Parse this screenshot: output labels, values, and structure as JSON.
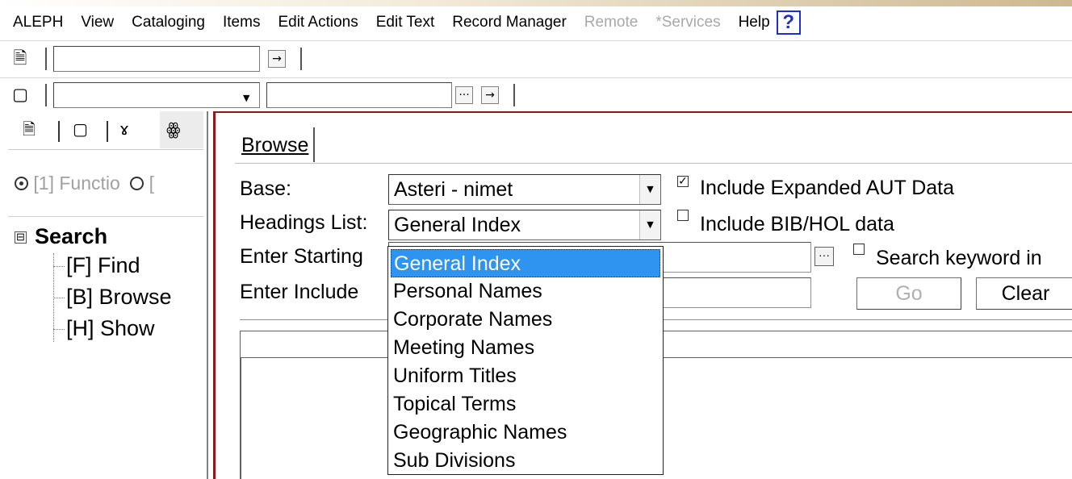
{
  "menubar": {
    "items": [
      {
        "label": "ALEPH",
        "disabled": false
      },
      {
        "label": "View",
        "disabled": false
      },
      {
        "label": "Cataloging",
        "disabled": false
      },
      {
        "label": "Items",
        "disabled": false
      },
      {
        "label": "Edit Actions",
        "disabled": false
      },
      {
        "label": "Edit Text",
        "disabled": false
      },
      {
        "label": "Record Manager",
        "disabled": false
      },
      {
        "label": "Remote",
        "disabled": true
      },
      {
        "label": "*Services",
        "disabled": true
      },
      {
        "label": "Help",
        "disabled": false
      }
    ],
    "help_glyph": "?"
  },
  "toolbar1": {
    "input_value": "",
    "go_glyph": "→"
  },
  "toolbar2": {
    "select_value": "",
    "input_value": "",
    "ellipsis_glyph": "···",
    "go_glyph": "→"
  },
  "left_panel": {
    "radio_labels": [
      "[1] Functio",
      "["
    ],
    "tree": {
      "root_label": "Search",
      "expander": "⊟",
      "children": [
        "[F] Find",
        "[B] Browse",
        "[H] Show"
      ]
    }
  },
  "main": {
    "tab_label": "Browse",
    "base": {
      "label": "Base:",
      "value": "Asteri - nimet"
    },
    "headings": {
      "label": "Headings List:",
      "value": "General Index"
    },
    "starting": {
      "label": "Enter Starting",
      "value": ""
    },
    "include": {
      "label": "Enter Include",
      "value": ""
    },
    "checkboxes": [
      {
        "label": "Include Expanded AUT Data",
        "checked": true
      },
      {
        "label": "Include BIB/HOL data",
        "checked": false
      },
      {
        "label": "Search keyword in",
        "checked": false
      }
    ],
    "go_label": "Go",
    "clear_label": "Clear",
    "ellipsis_glyph": "···"
  },
  "dropdown": {
    "selected_index": 0,
    "options": [
      "General Index",
      "Personal Names",
      "Corporate Names",
      "Meeting Names",
      "Uniform Titles",
      "Topical Terms",
      "Geographic Names",
      "Sub Divisions"
    ]
  },
  "colors": {
    "accent_border": "#8a1a1a",
    "selection": "#2f93f0",
    "help_blue": "#1d2fd0"
  }
}
